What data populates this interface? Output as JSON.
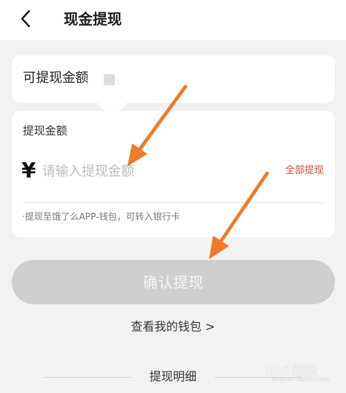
{
  "header": {
    "title": "现金提现",
    "back_icon": "chevron-left-icon"
  },
  "available": {
    "label": "可提现金额",
    "amount": ""
  },
  "withdraw": {
    "label": "提现金额",
    "currency_symbol": "¥",
    "input_value": "",
    "input_placeholder": "请输入提现金额",
    "all_button": "全部提现",
    "tip": "·提现至饿了么APP-钱包，可转入银行卡"
  },
  "confirm_button": "确认提现",
  "wallet_link": "查看我的钱包 >",
  "details_title": "提现明细",
  "watermark": {
    "text": "Bai 经验",
    "sub": "jingyan.baidu.com"
  },
  "colors": {
    "accent_red": "#e04a2f",
    "arrow_orange": "#f07a2b",
    "disabled_button": "#cfcfcf"
  }
}
